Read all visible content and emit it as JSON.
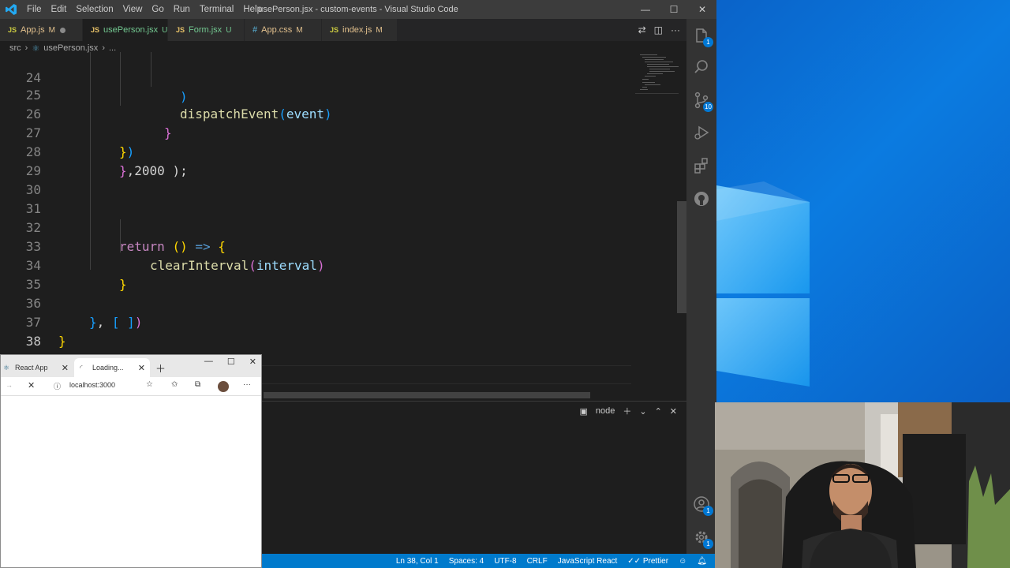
{
  "window": {
    "title": "usePerson.jsx - custom-events - Visual Studio Code"
  },
  "menu": [
    "File",
    "Edit",
    "Selection",
    "View",
    "Go",
    "Run",
    "Terminal",
    "Help"
  ],
  "tabs": [
    {
      "type": "JS",
      "label": "App.js",
      "status": "M"
    },
    {
      "type": "JS",
      "label": "usePerson.jsx",
      "status": "U"
    },
    {
      "type": "JS",
      "label": "Form.jsx",
      "status": "U"
    },
    {
      "type": "#",
      "label": "App.css",
      "status": "M"
    },
    {
      "type": "JS",
      "label": "index.js",
      "status": "M"
    }
  ],
  "breadcrumb": {
    "folder": "src",
    "file": "usePerson.jsx",
    "more": "..."
  },
  "editor": {
    "line_numbers": [
      "24",
      "25",
      "26",
      "27",
      "28",
      "29",
      "30",
      "31",
      "32",
      "33",
      "34",
      "35",
      "36",
      "37",
      "38"
    ],
    "tokens": {
      "l24": ")",
      "l25_fn": "dispatchEvent",
      "l25_open": "(",
      "l25_arg": "event",
      "l25_close": ")",
      "l26": "}",
      "l27_brace": "}",
      "l27_paren": ")",
      "l28_brace": "}",
      "l28_rest": ",2000 );",
      "l32_kw": "return",
      "l32_parens": "()",
      "l32_arrow": "=>",
      "l32_brace": "{",
      "l33_fn": "clearInterval",
      "l33_open": "(",
      "l33_arg": "interval",
      "l33_close": ")",
      "l34": "}",
      "l36_brace": "}",
      "l36_comma": ", ",
      "l36_arr": "[ ]",
      "l36_paren": ")",
      "l37": "}"
    }
  },
  "terminal": {
    "label": "node"
  },
  "activity_badges": {
    "explorer": "1",
    "source_control": "10",
    "accounts": "1",
    "settings": "1"
  },
  "statusbar": [
    "Ln 38, Col 1",
    "Spaces: 4",
    "UTF-8",
    "CRLF",
    "JavaScript React",
    "Prettier"
  ],
  "browser": {
    "tabs": [
      "React App",
      "Loading..."
    ],
    "url": "localhost:3000"
  },
  "colors": {
    "editor_bg": "#1e1e1e",
    "statusbar": "#007acc",
    "activitybar": "#333333"
  }
}
